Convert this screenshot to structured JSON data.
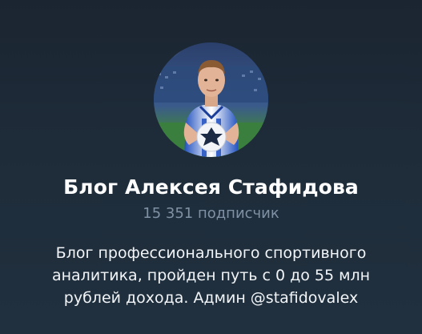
{
  "channel": {
    "title": "Блог Алексея Стафидова",
    "subscribers": "15 351 подписчик",
    "description": "Блог профессионального спортивного аналитика, пройден путь с 0 до 55 млн рублей дохода. Админ @stafidovalex"
  },
  "colors": {
    "background": "#1e2c3a",
    "title": "#ffffff",
    "subscribers": "#7f91a4",
    "description": "#f2f5f8"
  },
  "avatar": {
    "icon": "channel-avatar-photo"
  }
}
